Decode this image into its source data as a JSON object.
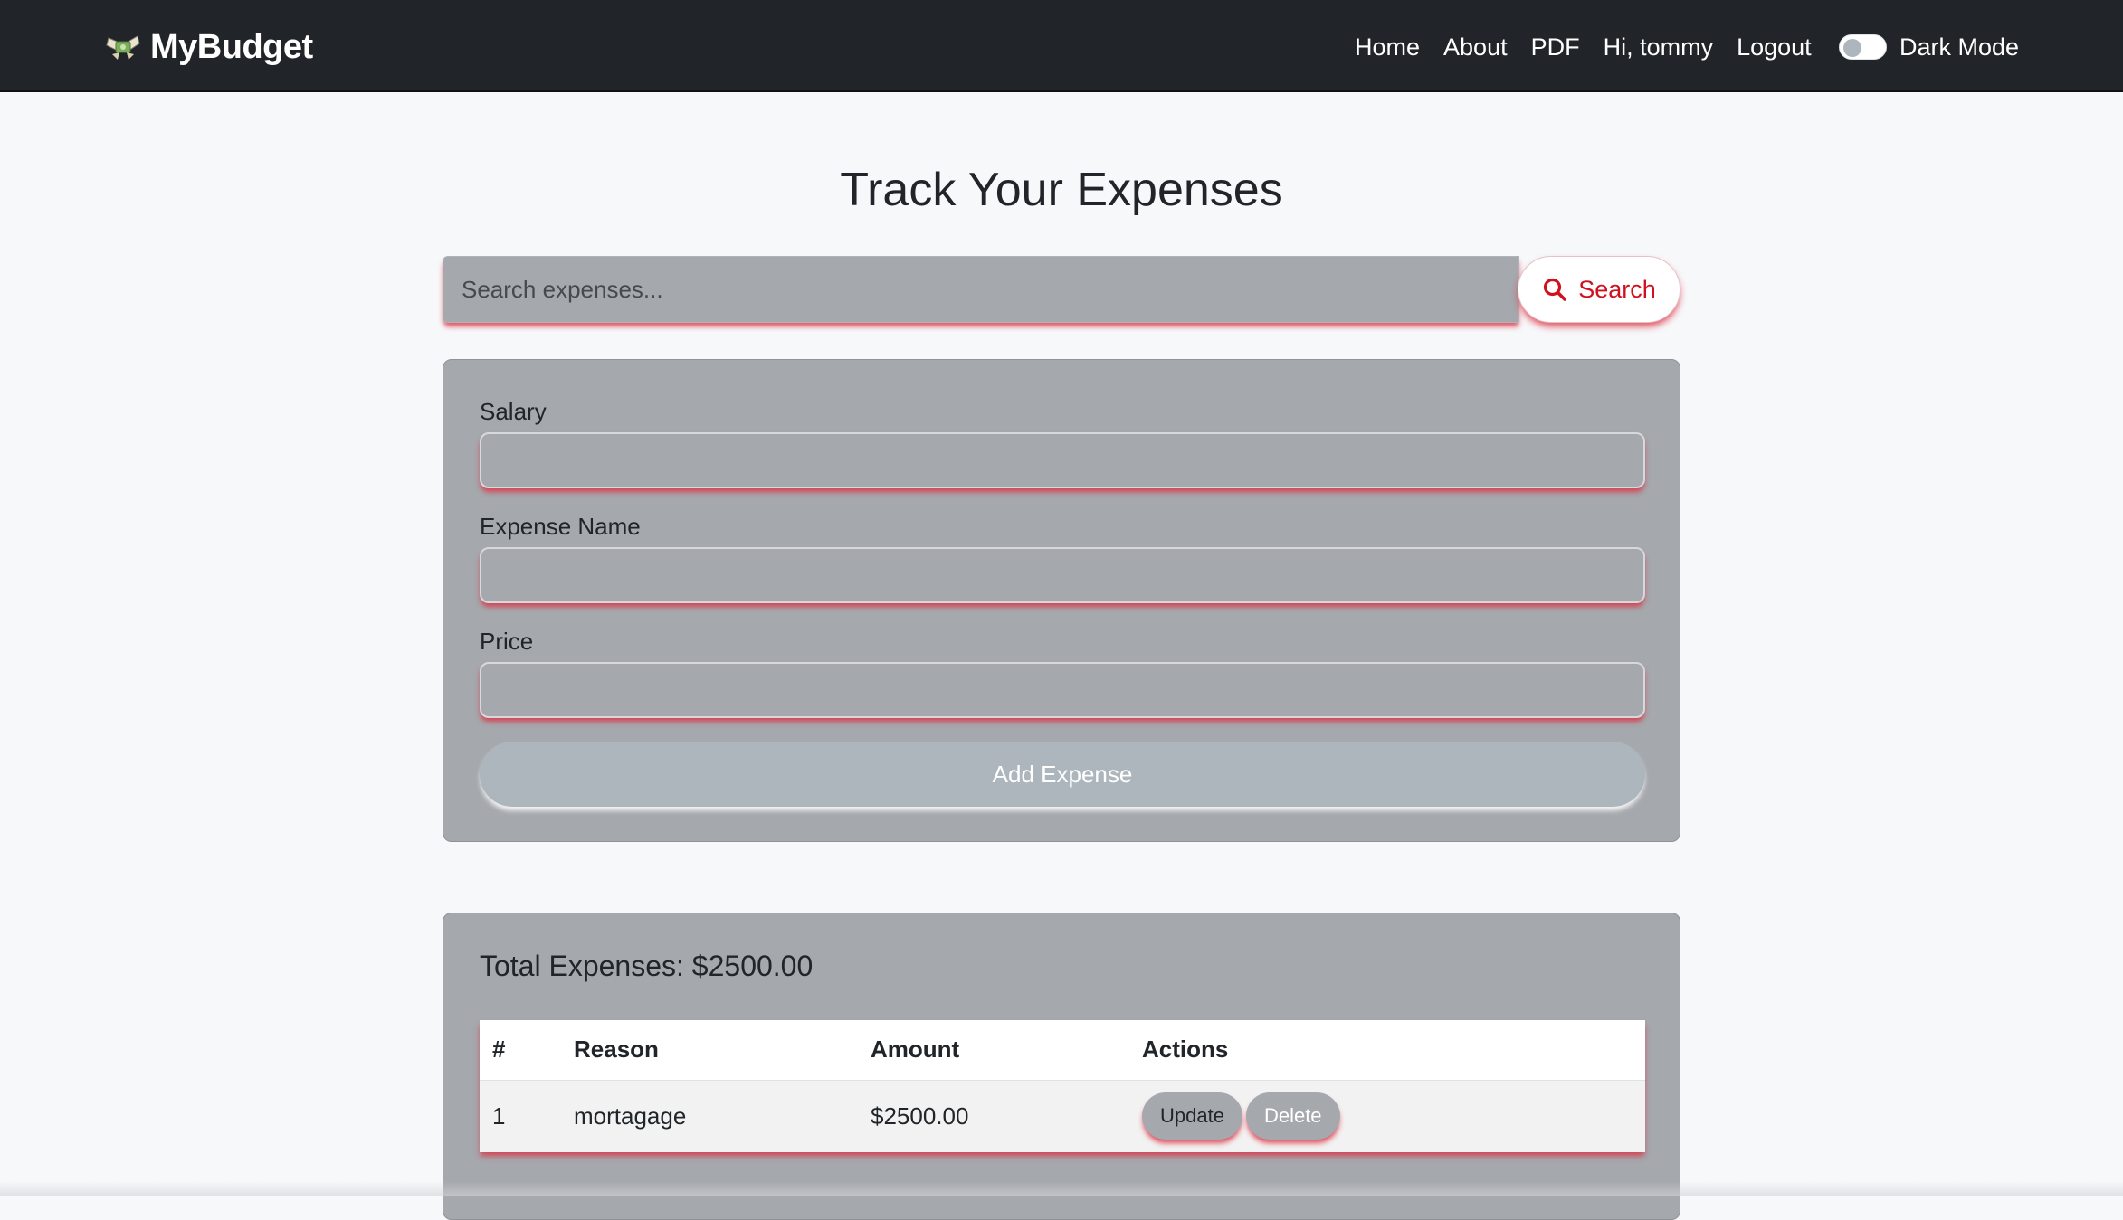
{
  "navbar": {
    "brand": "MyBudget",
    "brand_icon": "money-wings-icon",
    "links": [
      "Home",
      "About",
      "PDF",
      "Hi, tommy",
      "Logout"
    ],
    "dark_mode_label": "Dark Mode",
    "dark_mode_on": false
  },
  "main": {
    "title": "Track Your Expenses",
    "search": {
      "placeholder": "Search expenses...",
      "value": "",
      "button_label": "Search",
      "button_icon": "search-icon"
    },
    "form": {
      "salary_label": "Salary",
      "salary_value": "",
      "expense_name_label": "Expense Name",
      "expense_name_value": "",
      "price_label": "Price",
      "price_value": "",
      "submit_label": "Add Expense"
    },
    "expenses": {
      "total_text": "Total Expenses: $2500.00",
      "columns": [
        "#",
        "Reason",
        "Amount",
        "Actions"
      ],
      "rows": [
        {
          "num": "1",
          "reason": "mortagage",
          "amount": "$2500.00"
        }
      ],
      "update_label": "Update",
      "delete_label": "Delete"
    }
  },
  "colors": {
    "navbar_bg": "#212529",
    "page_bg": "#f7f8fa",
    "card_bg": "#a5a8ad",
    "accent_red": "#d1101f",
    "button_gray": "#adb5bd"
  }
}
